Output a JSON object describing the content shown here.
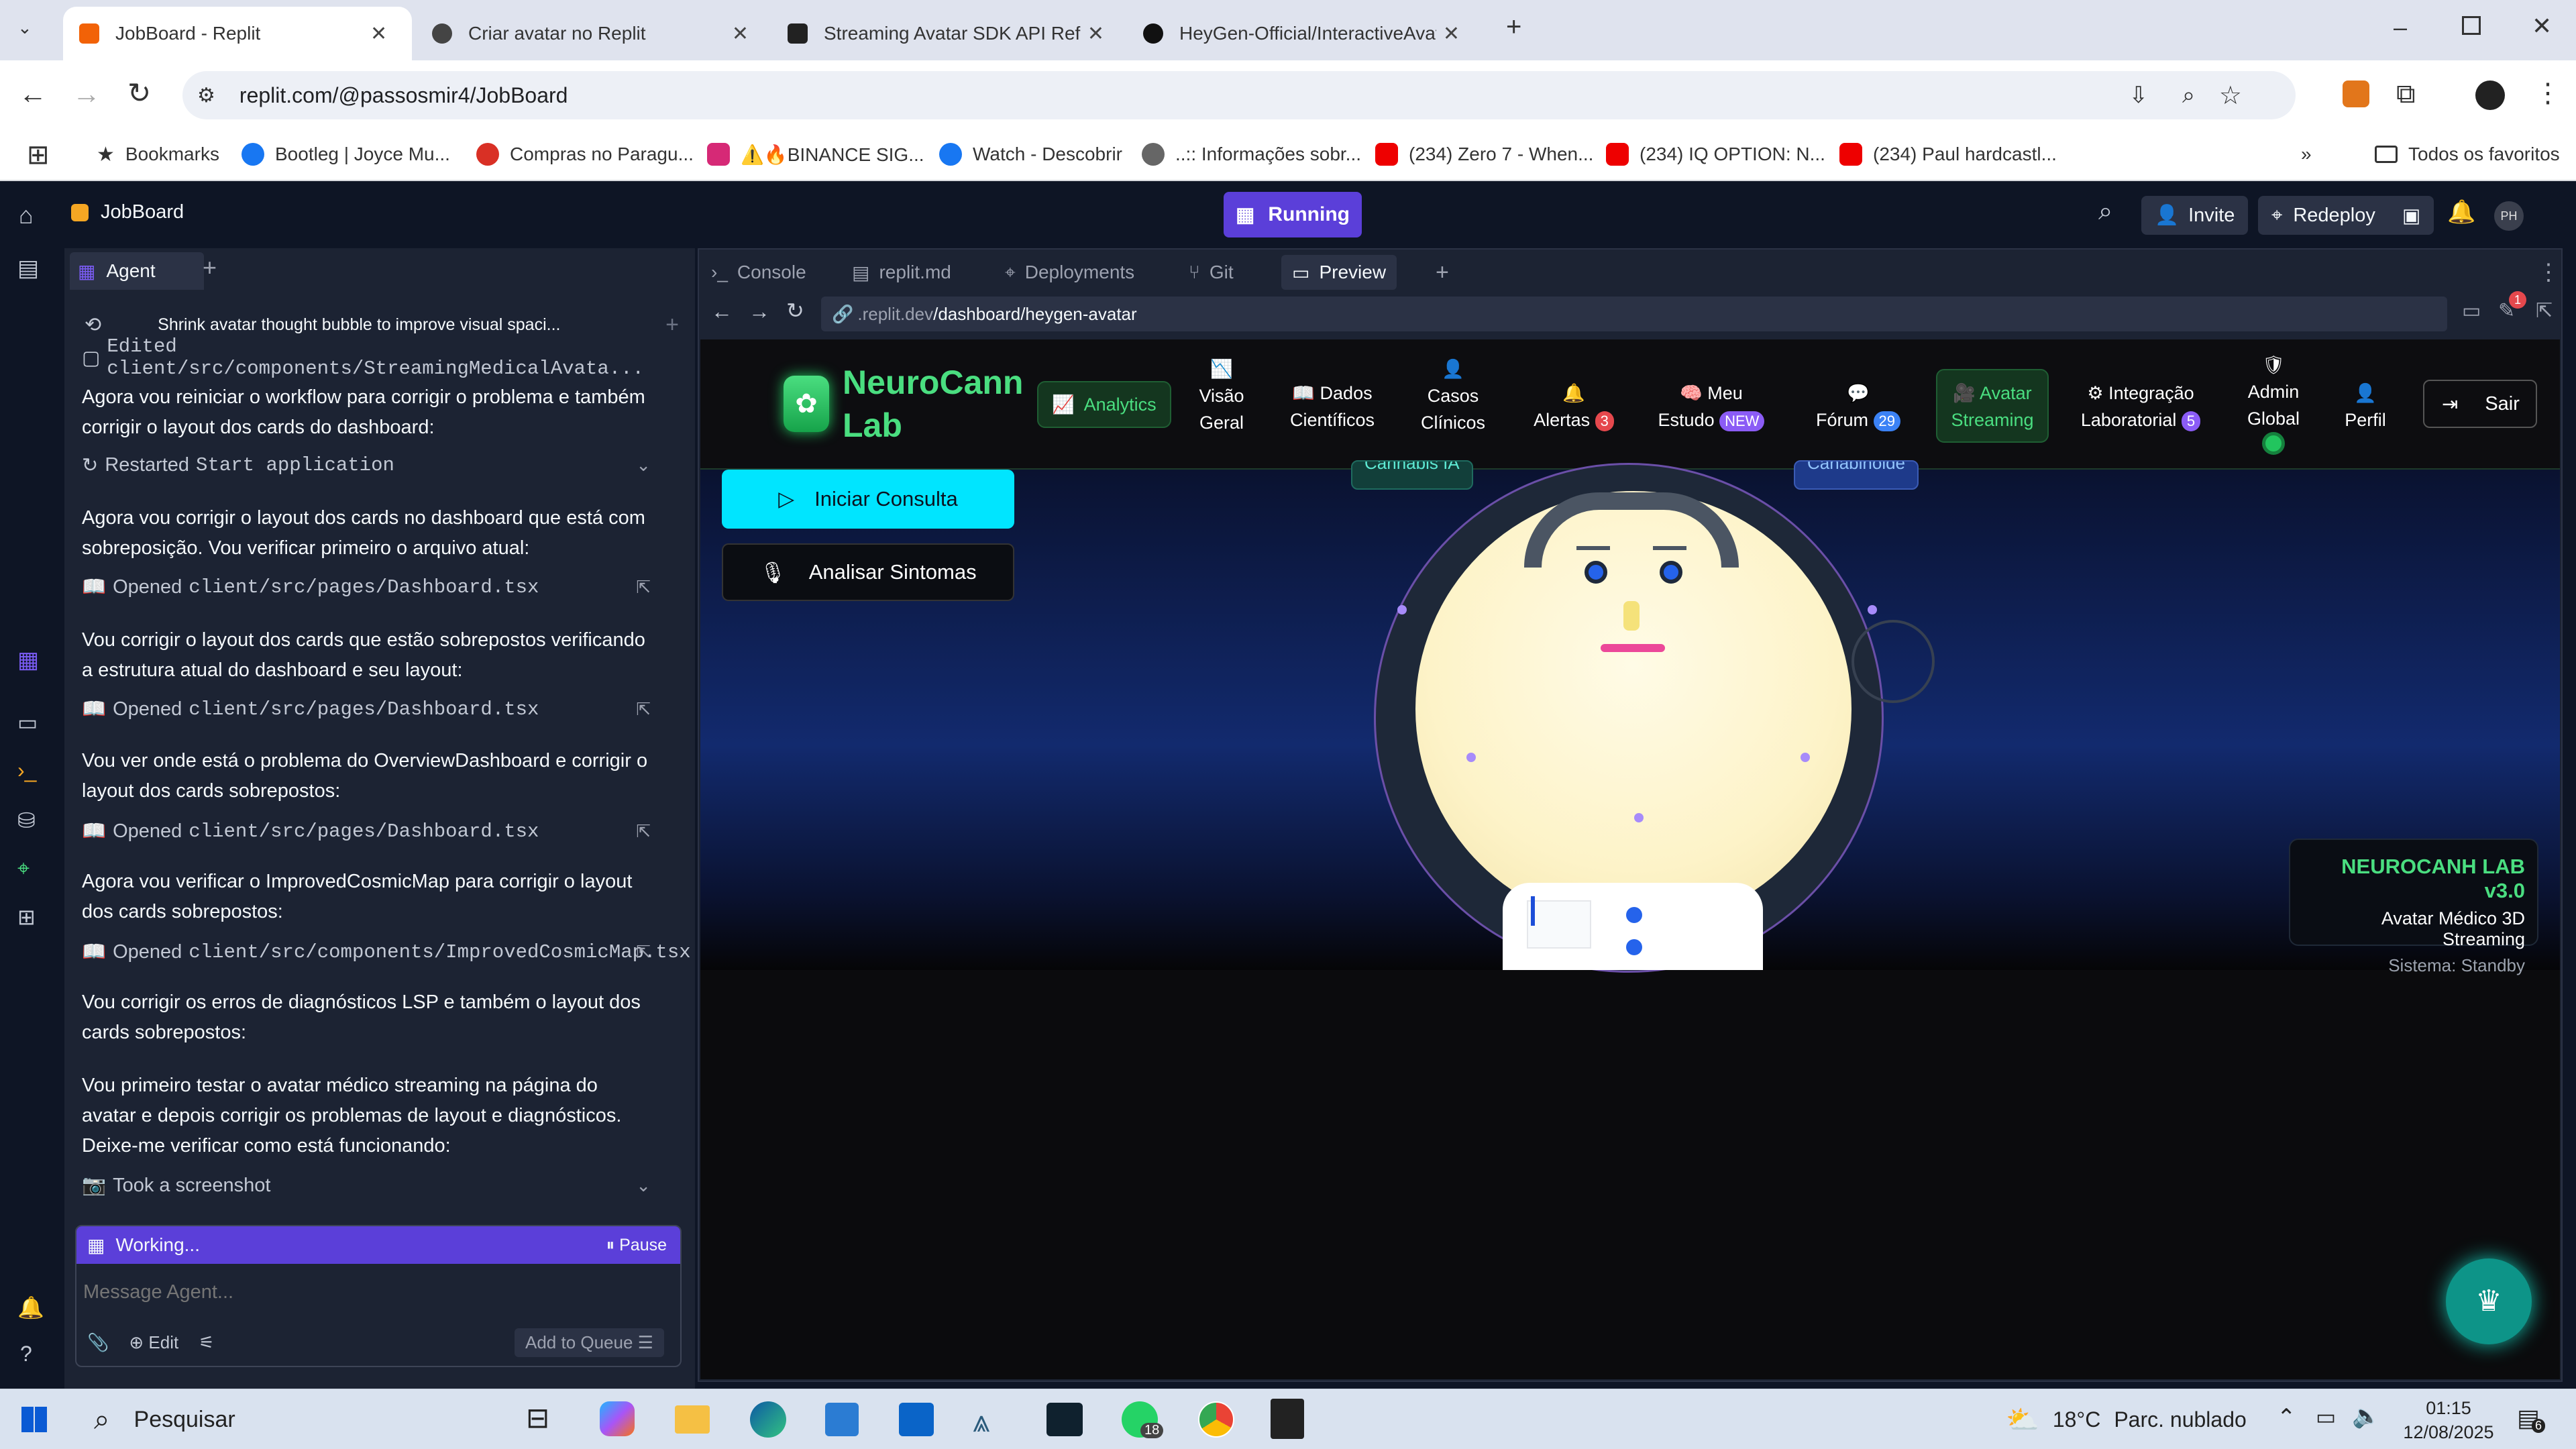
{
  "browser": {
    "tabs": [
      {
        "title": "JobBoard - Replit",
        "active": true
      },
      {
        "title": "Criar avatar no Replit",
        "active": false
      },
      {
        "title": "Streaming Avatar SDK API Refer",
        "active": false
      },
      {
        "title": "HeyGen-Official/InteractiveAvat",
        "active": false
      }
    ],
    "url": "replit.com/@passosmir4/JobBoard",
    "bookmarks": [
      "Bookmarks",
      "Bootleg | Joyce Mu...",
      "Compras no Paragu...",
      "⚠️🔥BINANCE SIG...",
      "Watch - Descobrir",
      "..:: Informações sobr...",
      "(234) Zero 7 - When...",
      "(234) IQ OPTION: N...",
      "(234) Paul hardcastl..."
    ],
    "all_bookmarks": "Todos os favoritos"
  },
  "replit": {
    "project": "JobBoard",
    "run_status": "Running",
    "invite": "Invite",
    "redeploy": "Redeploy",
    "avatar_initials": "PH",
    "agent_tab": "Agent",
    "history_title": "Shrink avatar thought bubble to improve visual spaci...",
    "edited_line": "Edited client/src/components/StreamingMedicalAvata...",
    "messages": [
      "Agora vou reiniciar o workflow para corrigir o problema e também corrigir o layout dos cards do dashboard:",
      "Agora vou corrigir o layout dos cards no dashboard que está com sobreposição. Vou verificar primeiro o arquivo atual:",
      "Vou corrigir o layout dos cards que estão sobrepostos verificando a estrutura atual do dashboard e seu layout:",
      "Vou ver onde está o problema do OverviewDashboard e corrigir o layout dos cards sobrepostos:",
      "Agora vou verificar o ImprovedCosmicMap para corrigir o layout dos cards sobrepostos:",
      "Vou corrigir os erros de diagnósticos LSP e também o layout dos cards sobrepostos:",
      "Vou primeiro testar o avatar médico streaming na página do avatar e depois corrigir os problemas de layout e diagnósticos. Deixe-me verificar como está funcionando:"
    ],
    "restarted": "Restarted",
    "restarted_target": "Start application",
    "opened_label": "Opened",
    "opened_files": [
      "client/src/pages/Dashboard.tsx",
      "client/src/pages/Dashboard.tsx",
      "client/src/pages/Dashboard.tsx",
      "client/src/components/ImprovedCosmicMap.tsx"
    ],
    "screenshot": "Took a screenshot",
    "working": "Working...",
    "pause": "Pause",
    "message_placeholder": "Message Agent...",
    "edit": "Edit",
    "add_to_queue": "Add to Queue",
    "workspace_tabs": [
      "Console",
      "replit.md",
      "Deployments",
      "Git",
      "Preview"
    ],
    "preview_url_prefix": ".replit.dev",
    "preview_url_path": "/dashboard/heygen-avatar",
    "preview_badge": "1"
  },
  "app": {
    "brand_line1": "NeuroCann",
    "brand_line2": "Lab",
    "nav": [
      {
        "label": "Analytics"
      },
      {
        "line1": "Visão",
        "line2": "Geral"
      },
      {
        "line1": "Dados",
        "line2": "Científicos"
      },
      {
        "line1": "Casos",
        "line2": "Clínicos"
      },
      {
        "line1": "Alertas",
        "badge": "3"
      },
      {
        "line1": "Meu",
        "line2": "Estudo",
        "badge": "NEW"
      },
      {
        "line1": "Fórum",
        "badge": "29"
      },
      {
        "line1": "Avatar",
        "line2": "Streaming"
      },
      {
        "line1": "Integração",
        "line2": "Laboratorial",
        "badge": "5"
      },
      {
        "line1": "Admin",
        "line2": "Global"
      },
      {
        "line1": "Perfil"
      }
    ],
    "logout": "Sair",
    "btn_consulta": "Iniciar Consulta",
    "btn_sintomas": "Analisar Sintomas",
    "chip_left": "Cannabis IA",
    "chip_right": "Canabinoide",
    "info_title": "NEUROCANH LAB v3.0",
    "info_subtitle": "Avatar Médico 3D Streaming",
    "info_status": "Sistema: Standby"
  },
  "taskbar": {
    "search": "Pesquisar",
    "whatsapp_badge": "18",
    "weather_temp": "18°C",
    "weather_desc": "Parc. nublado",
    "time": "01:15",
    "date": "12/08/2025",
    "notif": "6"
  },
  "colors": {
    "replit_bg": "#0e1525",
    "panel": "#1c2333",
    "accent_green": "#4ade80",
    "cyan": "#00e5ff",
    "purple": "#6d3bd8"
  }
}
